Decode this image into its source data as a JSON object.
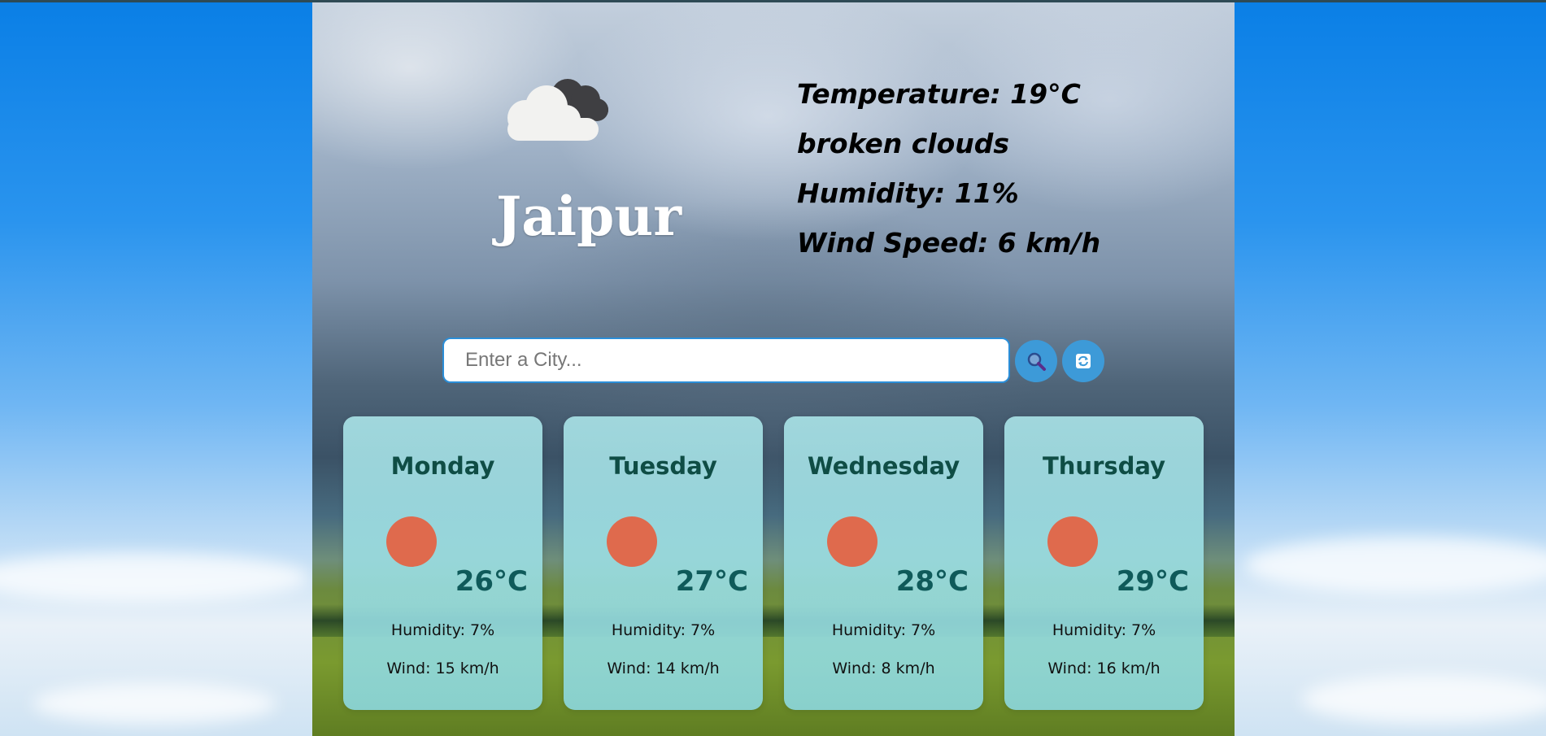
{
  "current": {
    "city": "Jaipur",
    "icon": "broken-clouds-icon",
    "temperature_line": "Temperature: 19°C",
    "description": "broken clouds",
    "humidity_line": "Humidity: 11%",
    "wind_line": "Wind Speed: 6 km/h"
  },
  "search": {
    "placeholder": "Enter a City...",
    "value": "",
    "search_icon": "search-icon",
    "refresh_icon": "refresh-icon"
  },
  "forecast": [
    {
      "day": "Monday",
      "icon": "sun-icon",
      "temp": "26°C",
      "humidity": "Humidity: 7%",
      "wind": "Wind: 15 km/h"
    },
    {
      "day": "Tuesday",
      "icon": "sun-icon",
      "temp": "27°C",
      "humidity": "Humidity: 7%",
      "wind": "Wind: 14 km/h"
    },
    {
      "day": "Wednesday",
      "icon": "sun-icon",
      "temp": "28°C",
      "humidity": "Humidity: 7%",
      "wind": "Wind: 8 km/h"
    },
    {
      "day": "Thursday",
      "icon": "sun-icon",
      "temp": "29°C",
      "humidity": "Humidity: 7%",
      "wind": "Wind: 16 km/h"
    }
  ],
  "colors": {
    "sun": "#df6a4d",
    "button": "#3d9ad8",
    "card_text": "#0f4d45"
  }
}
